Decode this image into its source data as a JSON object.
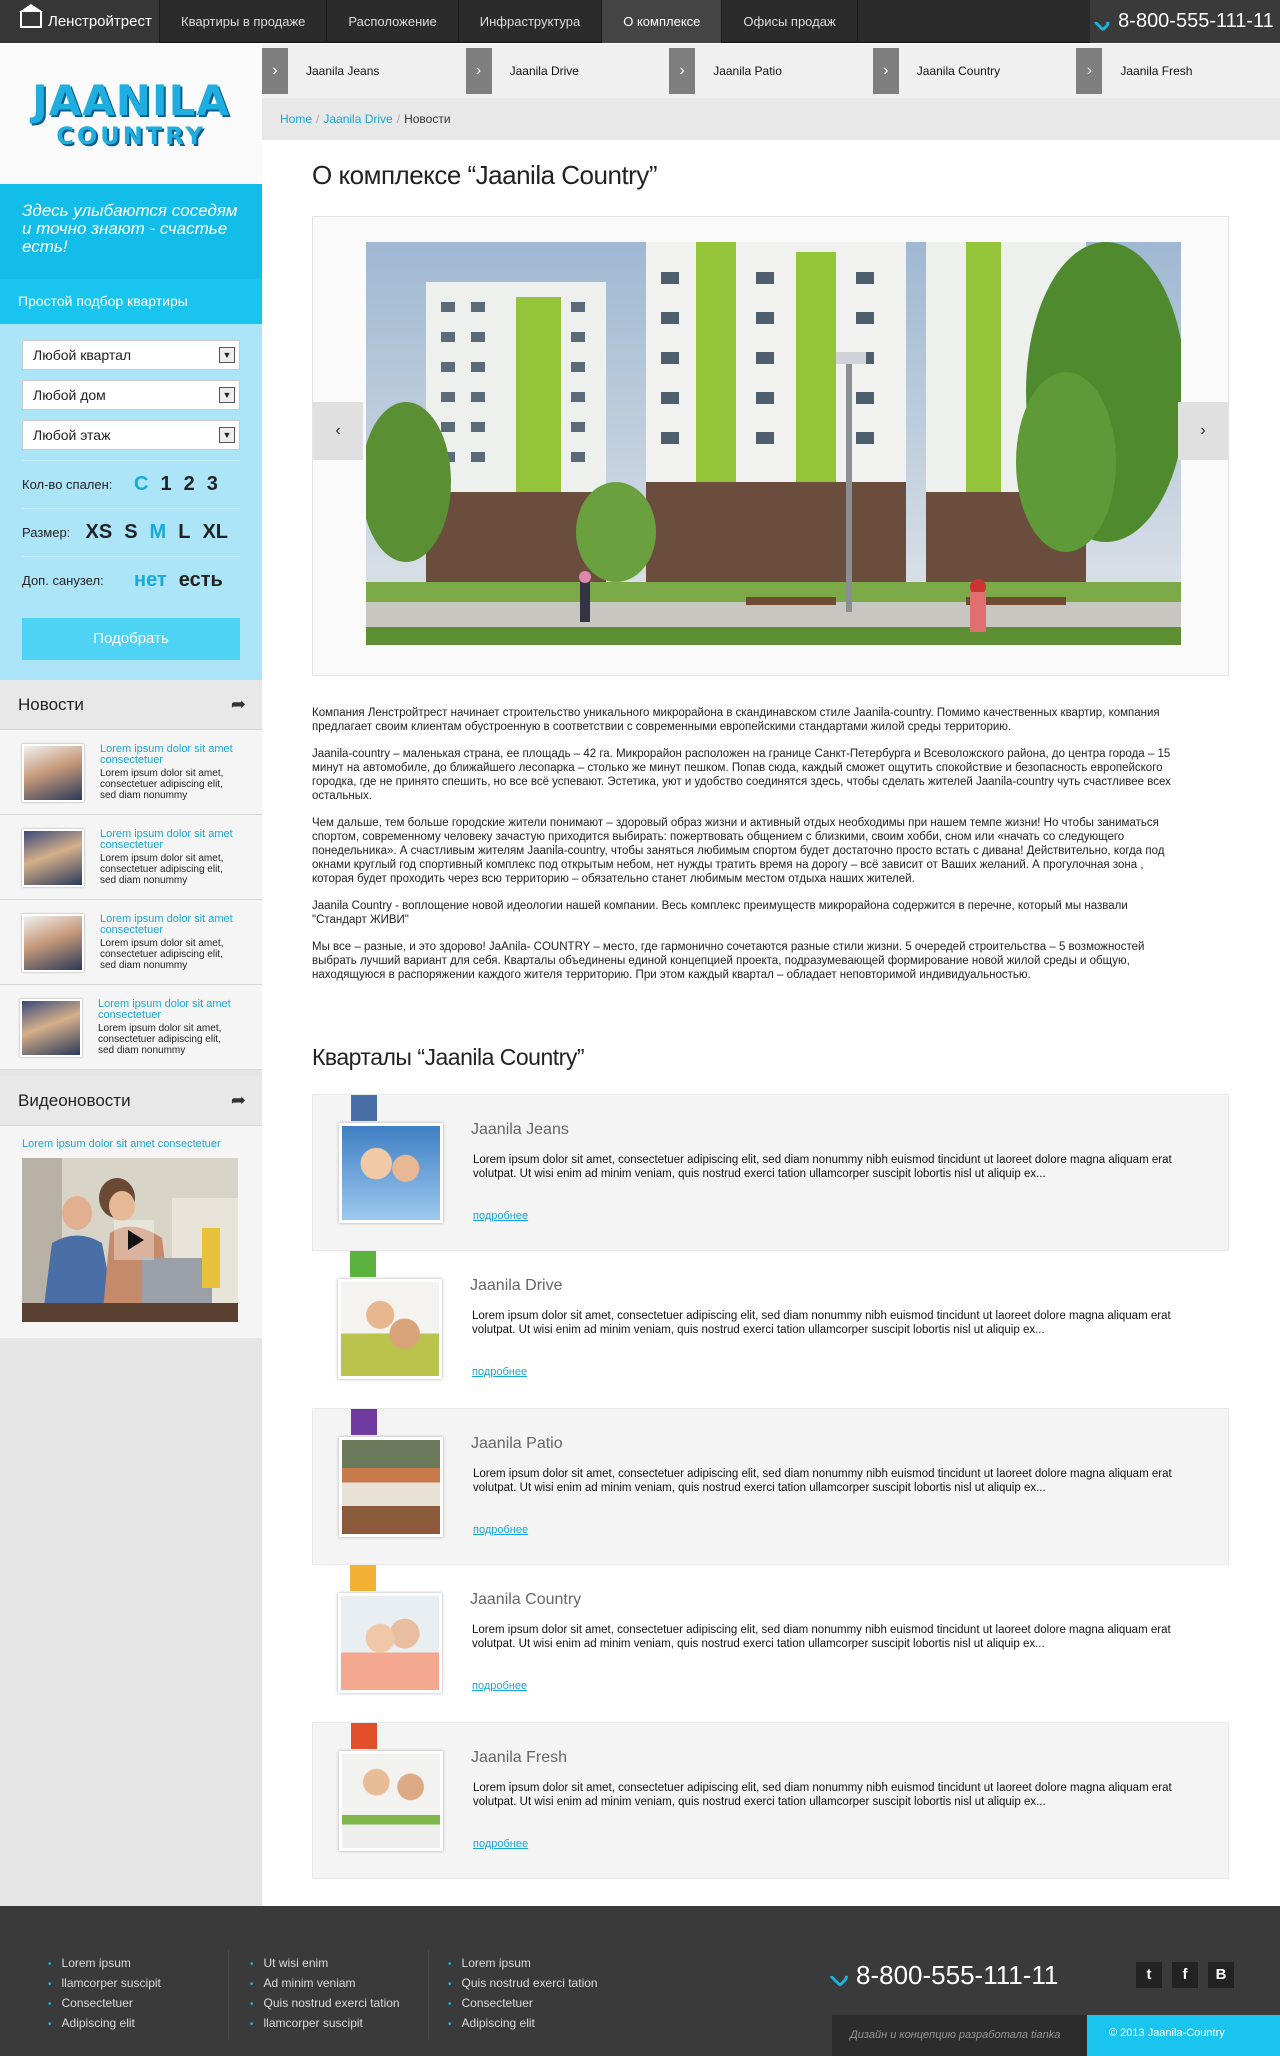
{
  "topbar": {
    "brand": "Ленстройтрест",
    "nav": [
      "Квартиры в продаже",
      "Расположение",
      "Инфраструктура",
      "О комплексе",
      "Офисы продаж"
    ],
    "active_index": 3,
    "phone": "8-800-555-111-11"
  },
  "sidebar": {
    "logo_line1": "JAANILA",
    "logo_line2": "COUNTRY",
    "slogan": "Здесь улыбаются соседям и точно знают - счастье есть!",
    "picker_title": "Простой подбор квартиры",
    "selects": [
      "Любой квартал",
      "Любой дом",
      "Любой этаж"
    ],
    "bedrooms_label": "Кол-во спален:",
    "bedrooms_options": [
      "С",
      "1",
      "2",
      "3"
    ],
    "size_label": "Размер:",
    "size_options": [
      "XS",
      "S",
      "M",
      "L",
      "XL"
    ],
    "bath_label": "Доп. санузел:",
    "bath_options": [
      "нет",
      "есть"
    ],
    "pick_button": "Подобрать",
    "news_title": "Новости",
    "news": [
      {
        "title": "Lorem ipsum dolor sit amet consectetuer",
        "body": "Lorem ipsum dolor sit amet, consectetuer adipiscing elit, sed diam nonummy"
      },
      {
        "title": "Lorem ipsum dolor sit amet consectetuer",
        "body": "Lorem ipsum dolor sit amet, consectetuer adipiscing elit, sed diam nonummy"
      },
      {
        "title": "Lorem ipsum dolor sit amet consectetuer",
        "body": "Lorem ipsum dolor sit amet, consectetuer adipiscing elit, sed diam nonummy"
      },
      {
        "title": "Lorem ipsum dolor sit amet consectetuer",
        "body": "Lorem ipsum dolor sit amet, consectetuer adipiscing elit, sed diam nonummy"
      }
    ],
    "video_title": "Видеоновости",
    "video_caption": "Lorem ipsum dolor sit amet consectetuer"
  },
  "subtabs": [
    "Jaanila Jeans",
    "Jaanila Drive",
    "Jaanila Patio",
    "Jaanila Country",
    "Jaanila Fresh"
  ],
  "breadcrumb": {
    "home": "Home",
    "parent": "Jaanila Drive",
    "current": "Новости",
    "separator": "/"
  },
  "page_title": "О комплексе “Jaanila Country”",
  "article": [
    "Компания Ленстройтрест начинает строительство уникального микрорайона в скандинавском стиле Jaanila-country. Помимо качественных квартир, компания предлагает своим клиентам обустроенную в соответствии с современными европейскими стандартами жилой среды территорию.",
    "Jaanila-country – маленькая страна, ее площадь – 42 га. Микрорайон расположен на границе Санкт-Петербурга и Всеволожского района, до центра города – 15 минут на автомобиле, до ближайшего лесопарка – столько же минут пешком. Попав сюда, каждый сможет ощутить спокойствие и безопасность европейского городка, где не принято спешить, но все всё успевают. Эстетика, уют и удобство соединятся здесь, чтобы сделать жителей Jaanila-country чуть счастливее всех остальных.",
    "Чем дальше, тем больше городские жители понимают – здоровый образ жизни и активный отдых необходимы при нашем темпе жизни! Но чтобы заниматься спортом, современному человеку зачастую приходится выбирать: пожертвовать общением с близкими, своим хобби, сном или «начать со следующего понедельника». А счастливым жителям Jaanila-country, чтобы заняться любимым спортом будет достаточно просто встать с дивана! Действительно, когда под окнами круглый год спортивный комплекс под открытым небом, нет нужды тратить время на дорогу – всё зависит от Ваших желаний. А прогулочная зона , которая будет проходить через всю территорию – обязательно станет любимым местом отдыха наших жителей.",
    "Jaanila Country - воплощение новой идеологии нашей компании. Весь комплекс преимуществ микрорайона содержится в перечне, который мы назвали \"Стандарт ЖИВИ\"",
    "Мы все – разные, и это здорово! JaAnila- COUNTRY – место, где гармонично сочетаются разные стили жизни. 5 очередей строительства – 5 возможностей выбрать лучший вариант для себя. Кварталы объединены единой концепцией проекта, подразумевающей формирование новой жилой среды и общую, находящуюся в распоряжении каждого жителя территорию. При этом каждый квартал – обладает неповторимой индивидуальностью."
  ],
  "quarters_title": "Кварталы “Jaanila Country”",
  "quarters": [
    {
      "name": "Jaanila Jeans",
      "color": "#4a6fa8",
      "text": "Lorem ipsum dolor sit amet, consectetuer adipiscing elit, sed diam nonummy nibh euismod tincidunt ut laoreet dolore magna aliquam erat volutpat. Ut wisi enim ad minim veniam, quis nostrud exerci tation ullamcorper suscipit lobortis nisl ut aliquip ex...",
      "more": "подробнее"
    },
    {
      "name": "Jaanila Drive",
      "color": "#5bb33e",
      "text": "Lorem ipsum dolor sit amet, consectetuer adipiscing elit, sed diam nonummy nibh euismod tincidunt ut laoreet dolore magna aliquam erat volutpat. Ut wisi enim ad minim veniam, quis nostrud exerci tation ullamcorper suscipit lobortis nisl ut aliquip ex...",
      "more": "подробнее"
    },
    {
      "name": "Jaanila Patio",
      "color": "#6f3b9e",
      "text": "Lorem ipsum dolor sit amet, consectetuer adipiscing elit, sed diam nonummy nibh euismod tincidunt ut laoreet dolore magna aliquam erat volutpat. Ut wisi enim ad minim veniam, quis nostrud exerci tation ullamcorper suscipit lobortis nisl ut aliquip ex...",
      "more": "подробнее"
    },
    {
      "name": "Jaanila Country",
      "color": "#f2b132",
      "text": "Lorem ipsum dolor sit amet, consectetuer adipiscing elit, sed diam nonummy nibh euismod tincidunt ut laoreet dolore magna aliquam erat volutpat. Ut wisi enim ad minim veniam, quis nostrud exerci tation ullamcorper suscipit lobortis nisl ut aliquip ex...",
      "more": "подробнее"
    },
    {
      "name": "Jaanila Fresh",
      "color": "#e2502b",
      "text": "Lorem ipsum dolor sit amet, consectetuer adipiscing elit, sed diam nonummy nibh euismod tincidunt ut laoreet dolore magna aliquam erat volutpat. Ut wisi enim ad minim veniam, quis nostrud exerci tation ullamcorper suscipit lobortis nisl ut aliquip ex...",
      "more": "подробнее"
    }
  ],
  "footer": {
    "col1": [
      "Lorem ipsum",
      "llamcorper suscipit",
      "Consectetuer",
      "Adipiscing elit"
    ],
    "col2": [
      "Ut wisi enim",
      "Ad minim veniam",
      "Quis nostrud exerci tation",
      "llamcorper suscipit"
    ],
    "col3": [
      "Lorem ipsum",
      "Quis nostrud exerci tation",
      "Consectetuer",
      "Adipiscing elit"
    ],
    "phone": "8-800-555-111-11",
    "social": [
      "t",
      "f",
      "B"
    ],
    "credit": "Дизайн и концепцию разработала tianka",
    "copyright": "© 2013 Jaanila-Country"
  }
}
